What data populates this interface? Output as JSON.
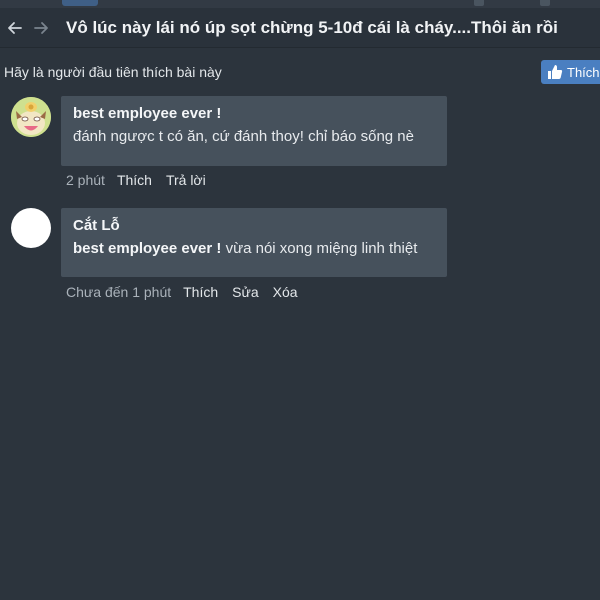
{
  "header": {
    "title": "Vô lúc này lái nó úp sọt chừng 5-10đ cái là cháy....Thôi ăn rồi",
    "back_icon": "arrow-left-icon",
    "forward_icon": "arrow-right-icon"
  },
  "likes": {
    "prompt": "Hãy là người đầu tiên thích bài này",
    "button_label": "Thích",
    "button_icon": "thumbs-up-icon",
    "accent": "#4a7fc1"
  },
  "comments": [
    {
      "author": "best employee ever !",
      "text": "đánh ngược t có ăn, cứ đánh thoy! chỉ báo sống nè",
      "time": "2 phút",
      "actions": [
        "Thích",
        "Trả lời"
      ]
    },
    {
      "author": "Cắt Lỗ",
      "mention": "best employee ever !",
      "text": " vừa nói xong miệng linh thiệt",
      "time": "Chưa đến 1 phút",
      "actions": [
        "Thích",
        "Sửa",
        "Xóa"
      ]
    }
  ]
}
